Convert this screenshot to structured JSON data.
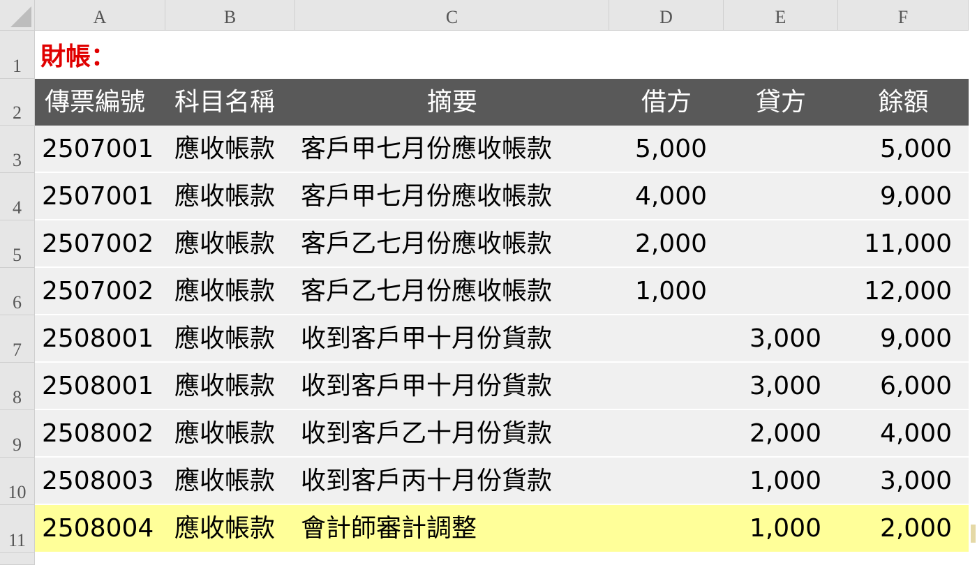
{
  "columns": [
    "A",
    "B",
    "C",
    "D",
    "E",
    "F"
  ],
  "row_numbers": [
    "1",
    "2",
    "3",
    "4",
    "5",
    "6",
    "7",
    "8",
    "9",
    "10",
    "11"
  ],
  "sheet_title": "財帳：",
  "table_header": {
    "voucher": "傳票編號",
    "account": "科目名稱",
    "summary": "摘要",
    "debit": "借方",
    "credit": "貸方",
    "balance": "餘額"
  },
  "rows": [
    {
      "voucher": "2507001",
      "account": "應收帳款",
      "summary": "客戶甲七月份應收帳款",
      "debit": "5,000",
      "credit": "",
      "balance": "5,000"
    },
    {
      "voucher": "2507001",
      "account": "應收帳款",
      "summary": "客戶甲七月份應收帳款",
      "debit": "4,000",
      "credit": "",
      "balance": "9,000"
    },
    {
      "voucher": "2507002",
      "account": "應收帳款",
      "summary": "客戶乙七月份應收帳款",
      "debit": "2,000",
      "credit": "",
      "balance": "11,000"
    },
    {
      "voucher": "2507002",
      "account": "應收帳款",
      "summary": "客戶乙七月份應收帳款",
      "debit": "1,000",
      "credit": "",
      "balance": "12,000"
    },
    {
      "voucher": "2508001",
      "account": "應收帳款",
      "summary": "收到客戶甲十月份貨款",
      "debit": "",
      "credit": "3,000",
      "balance": "9,000"
    },
    {
      "voucher": "2508001",
      "account": "應收帳款",
      "summary": "收到客戶甲十月份貨款",
      "debit": "",
      "credit": "3,000",
      "balance": "6,000"
    },
    {
      "voucher": "2508002",
      "account": "應收帳款",
      "summary": "收到客戶乙十月份貨款",
      "debit": "",
      "credit": "2,000",
      "balance": "4,000"
    },
    {
      "voucher": "2508003",
      "account": "應收帳款",
      "summary": "收到客戶丙十月份貨款",
      "debit": "",
      "credit": "1,000",
      "balance": "3,000"
    },
    {
      "voucher": "2508004",
      "account": "應收帳款",
      "summary": "會計師審計調整",
      "debit": "",
      "credit": "1,000",
      "balance": "2,000"
    }
  ],
  "colors": {
    "header_bg": "#595959",
    "row_bg": "#f0f0f0",
    "highlight_bg": "#ffff99",
    "title_red": "#e00000"
  }
}
